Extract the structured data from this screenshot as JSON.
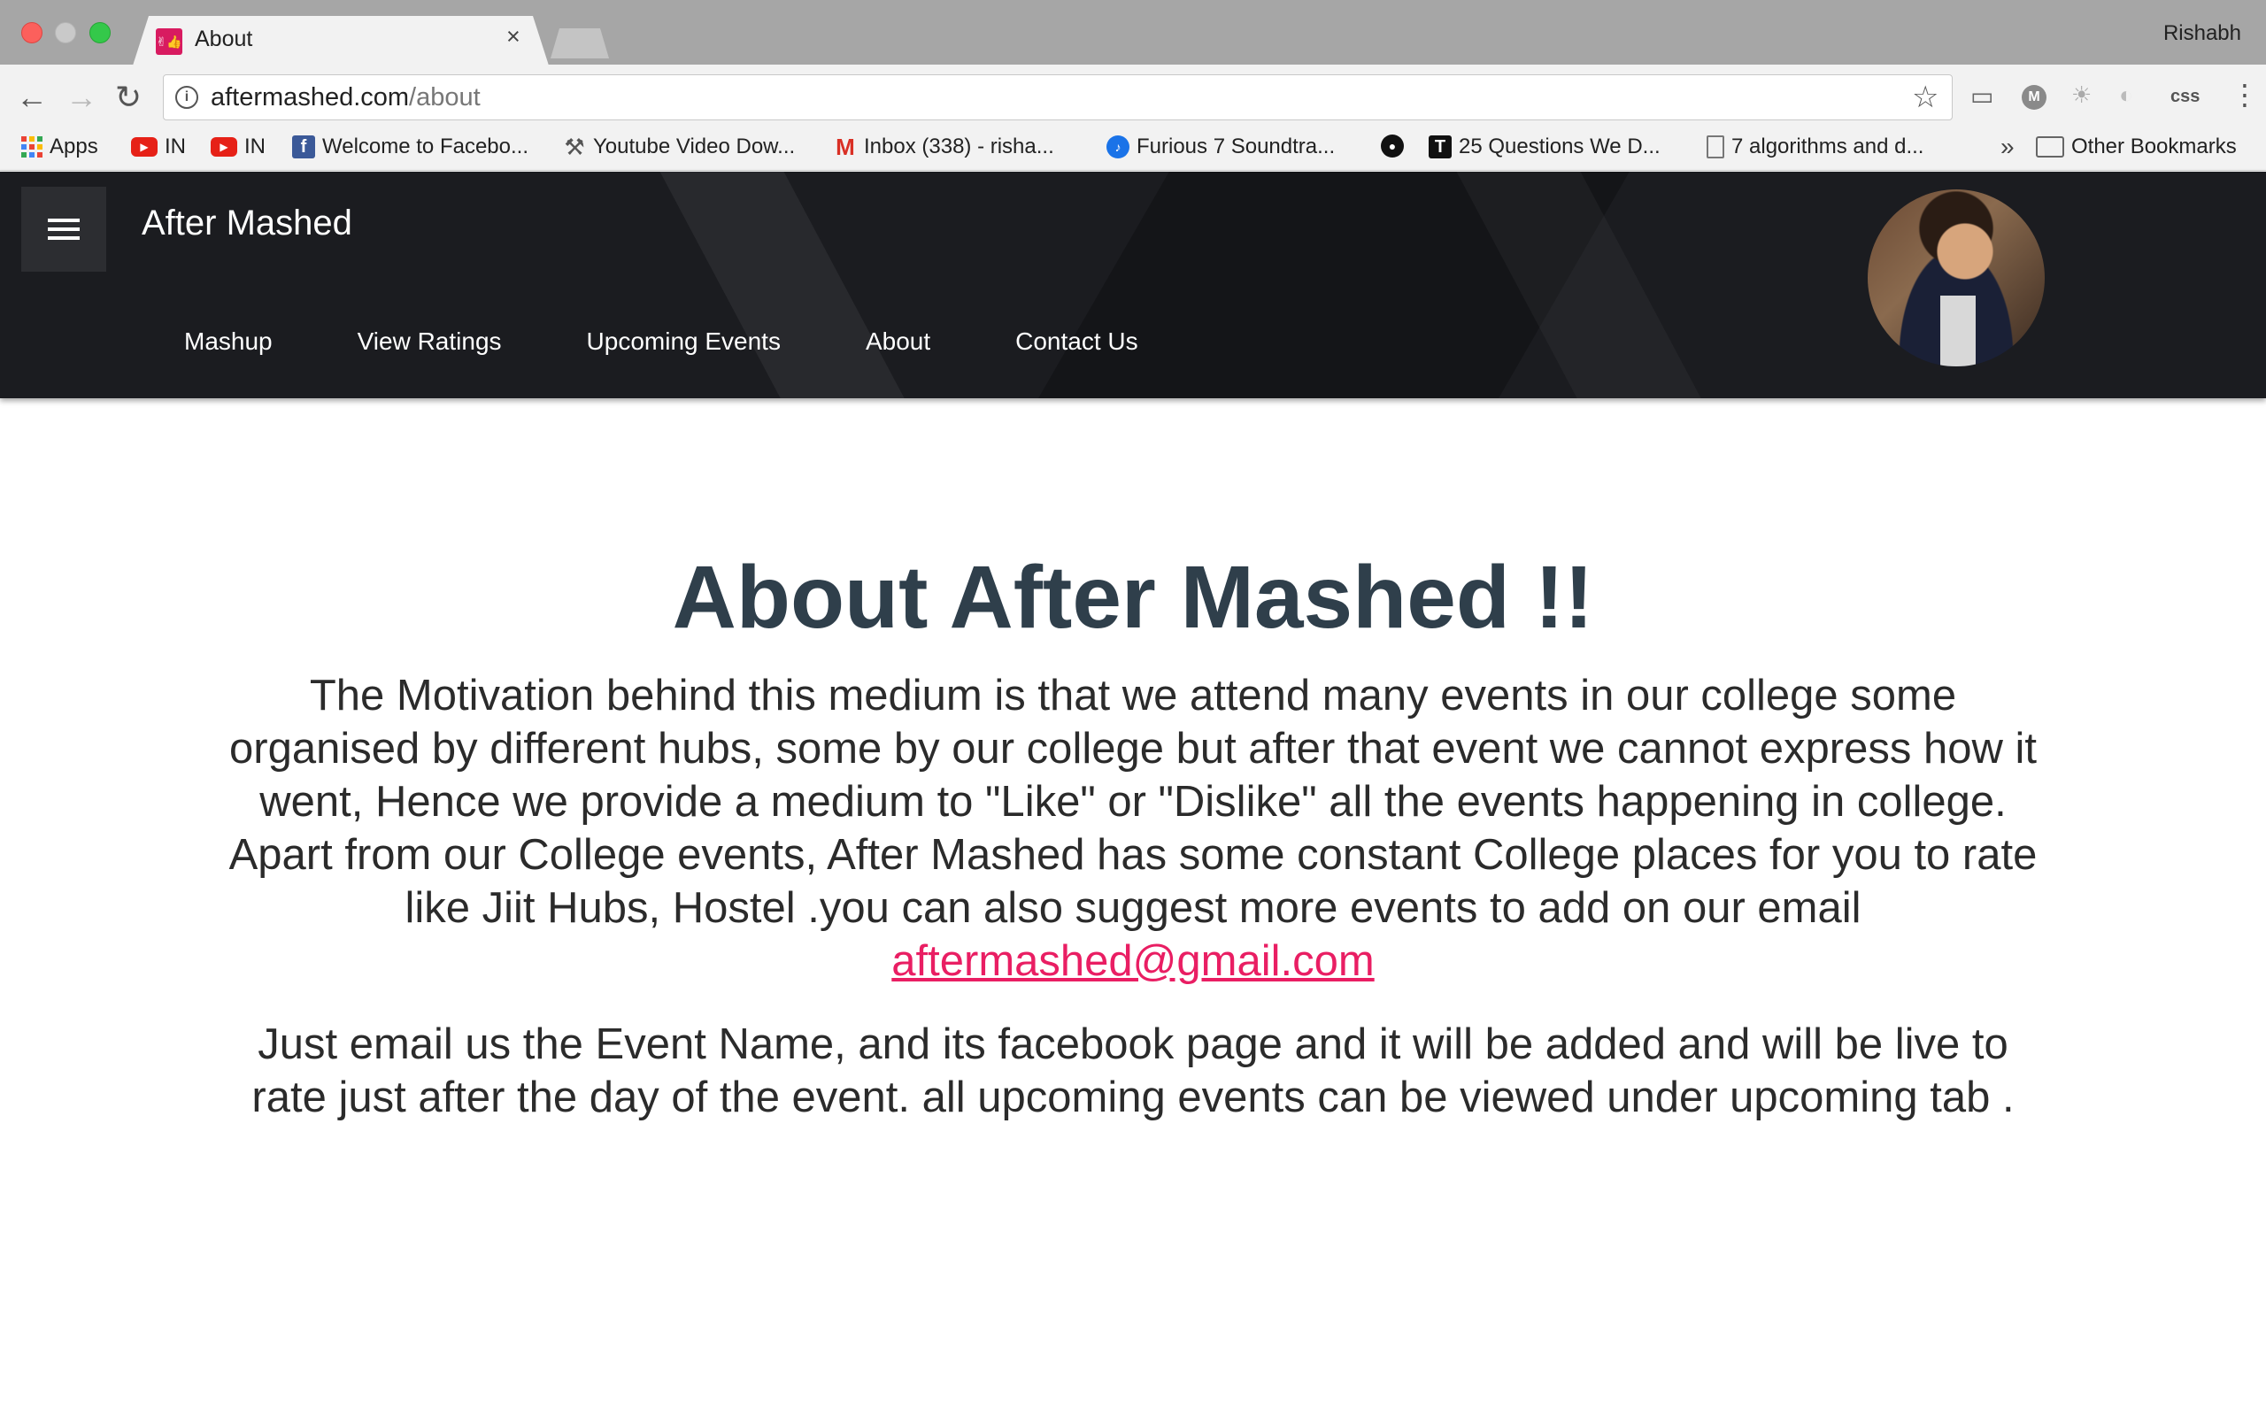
{
  "browser": {
    "tab_title": "About",
    "tab_favicon_text": "✌👍",
    "profile_name": "Rishabh",
    "url_domain": "aftermashed.com",
    "url_path": "/about",
    "extension_css_label": "css",
    "extension_m_label": "M",
    "bookmarks": [
      {
        "label": "Apps",
        "icon": "apps-grid-icon"
      },
      {
        "label": "IN",
        "icon": "youtube-icon"
      },
      {
        "label": "IN",
        "icon": "youtube-icon"
      },
      {
        "label": "Welcome to Facebo...",
        "icon": "facebook-icon"
      },
      {
        "label": "Youtube Video Dow...",
        "icon": "tool-icon"
      },
      {
        "label": "Inbox (338) - risha...",
        "icon": "gmail-icon"
      },
      {
        "label": "Furious 7 Soundtra...",
        "icon": "drop-icon"
      },
      {
        "label": "",
        "icon": "github-icon"
      },
      {
        "label": "25 Questions We D...",
        "icon": "t-icon"
      },
      {
        "label": "7 algorithms and d...",
        "icon": "document-icon"
      }
    ],
    "bookmarks_overflow": "»",
    "other_bookmarks": "Other Bookmarks"
  },
  "site": {
    "brand": "After Mashed",
    "nav": [
      "Mashup",
      "View Ratings",
      "Upcoming Events",
      "About",
      "Contact Us"
    ]
  },
  "content": {
    "heading": "About After Mashed !!",
    "paragraph1": "The Motivation behind this medium is that we attend many events in our college some organised by different hubs, some by our college but after that event we cannot express how it went, Hence we provide a medium to \"Like\" or \"Dislike\" all the events happening in college. Apart from our College events, After Mashed has some constant College places for you to rate like Jiit Hubs, Hostel .you can also suggest more events to add on our email",
    "email": "aftermashed@gmail.com",
    "paragraph2": "Just email us the Event Name, and its facebook page and it will be added and will be live to rate just after the day of the event. all upcoming events can be viewed under upcoming tab ."
  },
  "colors": {
    "header_bg": "#1b1c20",
    "heading_text": "#2f3f4b",
    "link": "#e91e63"
  }
}
